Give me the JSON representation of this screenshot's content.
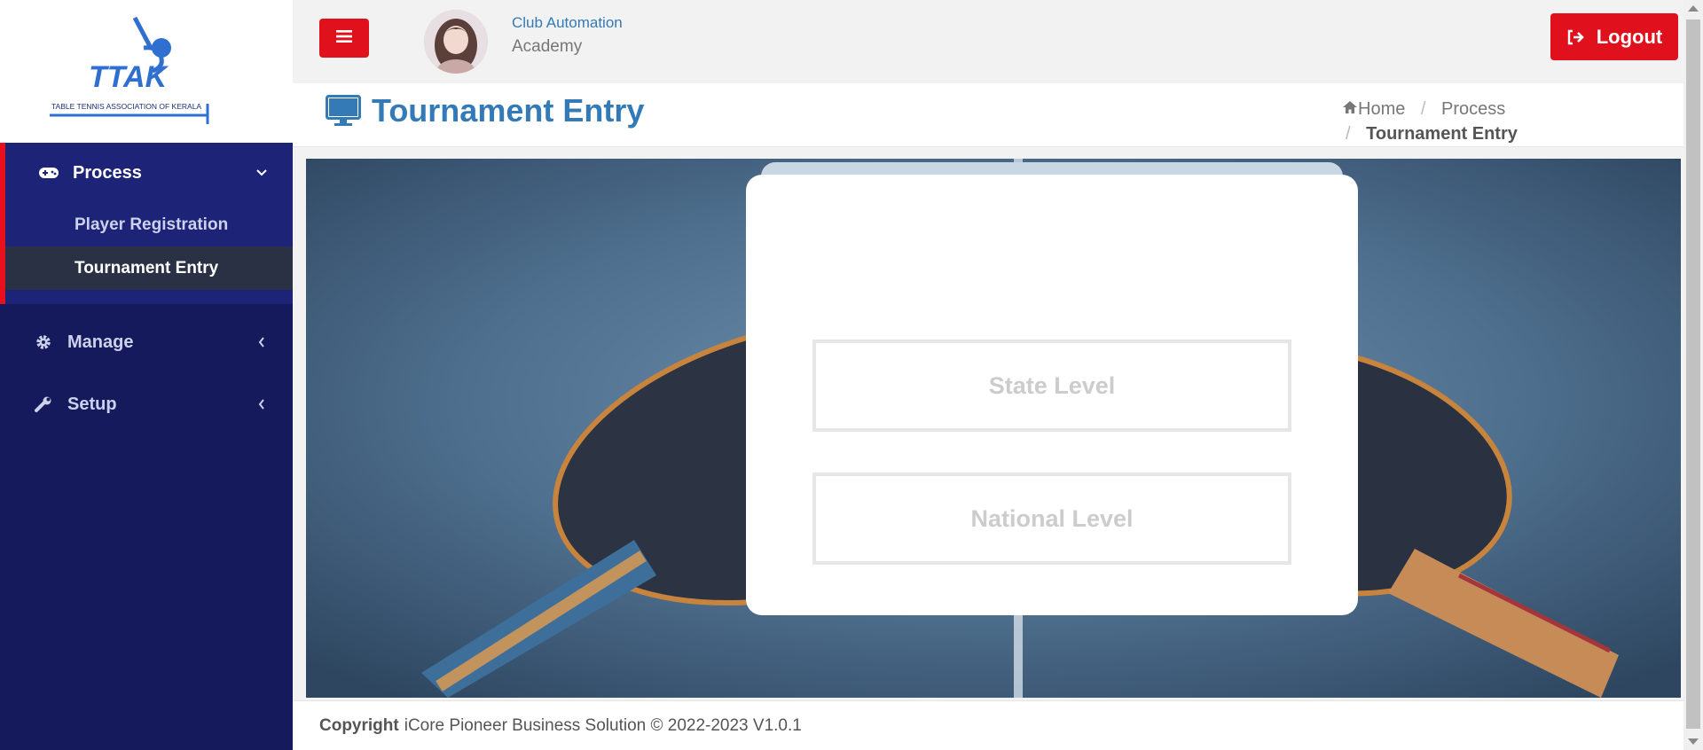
{
  "brand": {
    "logo_text": "TTAK",
    "logo_caption": "TABLE TENNIS ASSOCIATION OF KERALA",
    "colors": {
      "sidebar": "#141a5c",
      "accent_red": "#e0101c",
      "link_blue": "#337ab7"
    }
  },
  "sidebar": {
    "groups": [
      {
        "label": "Process",
        "icon": "gamepad-icon",
        "expanded": true,
        "items": [
          {
            "label": "Player Registration",
            "active": false
          },
          {
            "label": "Tournament Entry",
            "active": true
          }
        ]
      },
      {
        "label": "Manage",
        "icon": "gear-icon",
        "expanded": false
      },
      {
        "label": "Setup",
        "icon": "wrench-icon",
        "expanded": false
      }
    ]
  },
  "header": {
    "menu_icon": "hamburger-icon",
    "user_org": "Club Automation",
    "user_role": "Academy",
    "logout_label": "Logout",
    "logout_icon": "sign-out-icon"
  },
  "page": {
    "title": "Tournament Entry",
    "title_icon": "monitor-icon",
    "breadcrumb": {
      "home": "Home",
      "process": "Process",
      "current": "Tournament Entry"
    }
  },
  "main": {
    "options": [
      {
        "label": "State Level"
      },
      {
        "label": "National Level"
      }
    ]
  },
  "footer": {
    "copyright_label": "Copyright",
    "text": "iCore Pioneer Business Solution © 2022-2023 V1.0.1"
  }
}
